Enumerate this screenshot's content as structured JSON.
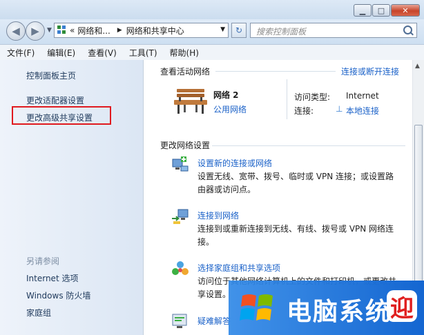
{
  "window": {
    "controls": {
      "minimize": "▁",
      "maximize": "□",
      "close": "✕"
    }
  },
  "navigation": {
    "back_icon": "◀",
    "forward_icon": "▶",
    "address_breadcrumbs": [
      "«",
      "网络和...",
      "网络和共享中心"
    ],
    "refresh_icon": "↻",
    "search_placeholder": "搜索控制面板"
  },
  "menubar": {
    "items": [
      "文件(F)",
      "编辑(E)",
      "查看(V)",
      "工具(T)",
      "帮助(H)"
    ]
  },
  "left_pane": {
    "links": [
      "控制面板主页",
      "更改适配器设置",
      "更改高级共享设置"
    ],
    "see_also_heading": "另请参阅",
    "see_also": [
      "Internet 选项",
      "Windows 防火墙",
      "家庭组"
    ]
  },
  "active_networks": {
    "title": "查看活动网络",
    "connect_link": "连接或断开连接",
    "network": {
      "name": "网络  2",
      "type": "公用网络"
    },
    "access_type_label": "访问类型:",
    "access_type_value": "Internet",
    "connections_label": "连接:",
    "connections_value": "本地连接"
  },
  "change_settings": {
    "title": "更改网络设置",
    "tasks": [
      {
        "icon": "new-connection-icon",
        "title": "设置新的连接或网络",
        "desc": "设置无线、宽带、拨号、临时或 VPN 连接；或设置路由器或访问点。"
      },
      {
        "icon": "connect-network-icon",
        "title": "连接到网络",
        "desc": "连接到或重新连接到无线、有线、拨号或 VPN 网络连接。"
      },
      {
        "icon": "homegroup-icon",
        "title": "选择家庭组和共享选项",
        "desc": "访问位于其他网络计算机上的文件和打印机，或更改共享设置。"
      },
      {
        "icon": "troubleshoot-icon",
        "title": "疑难解答",
        "desc": ""
      }
    ]
  },
  "watermark": {
    "text": "电脑系统",
    "badge": "迎"
  },
  "colors": {
    "link": "#1a61c8",
    "highlight_border": "#e0191e",
    "watermark_bg": "#1466d1"
  }
}
